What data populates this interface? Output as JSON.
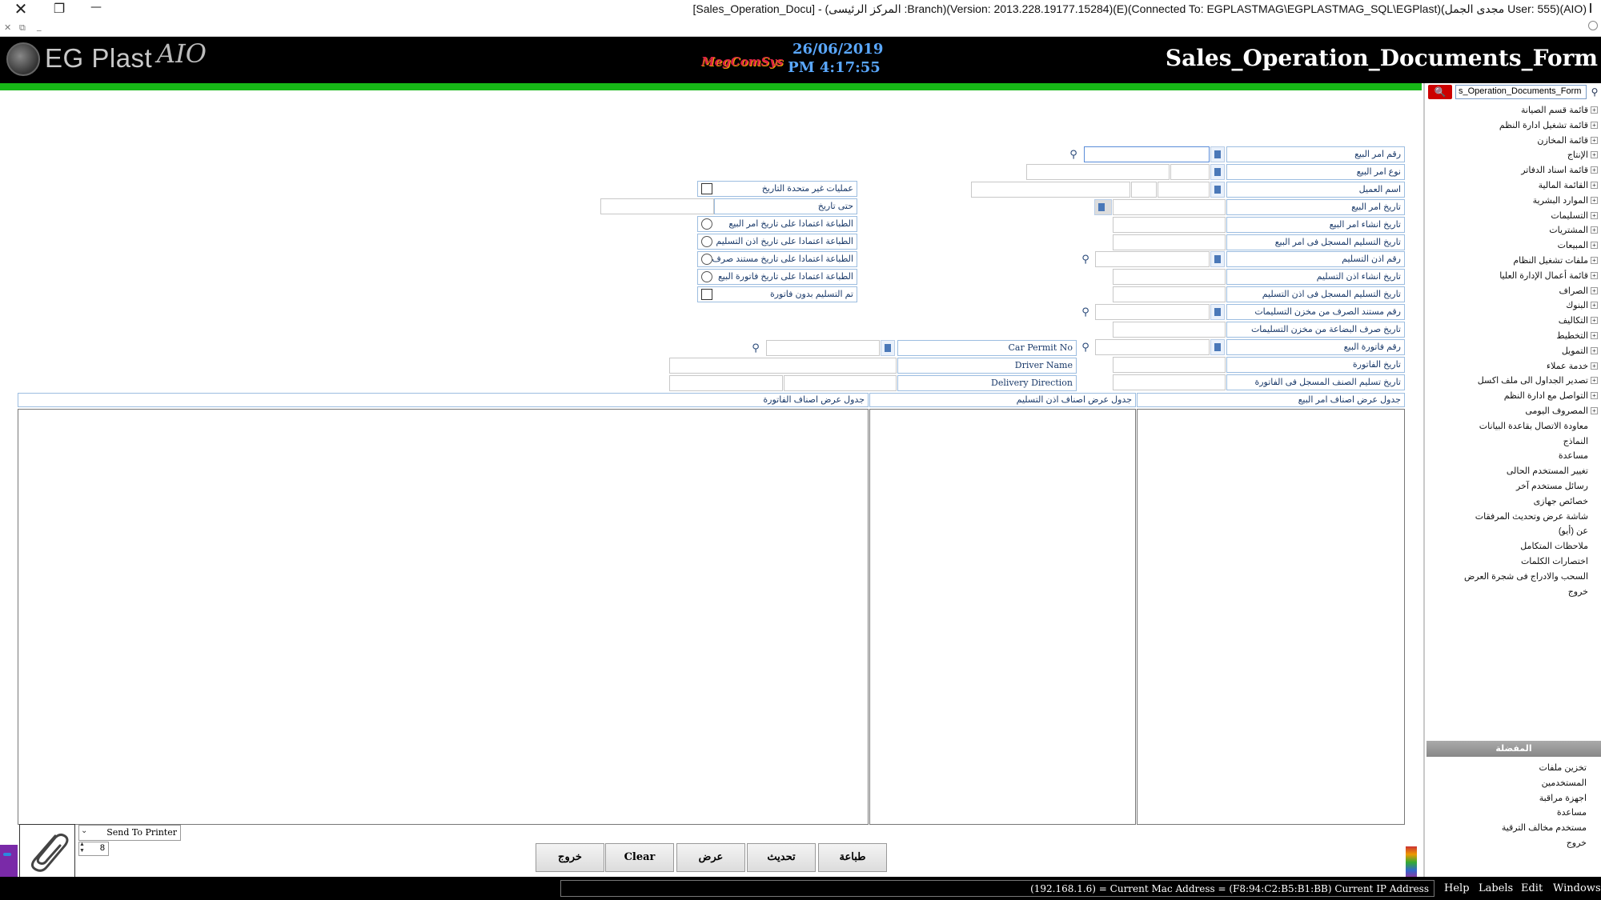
{
  "window": {
    "title": "[Sales_Operation_Docu] - (المركز الرئيسى :Branch)(Version: 2013.228.19177.15284)(E)(Connected To: EGPLASTMAG\\EGPLASTMAG_SQL\\EGPlast)(مجدى الجمل User: 555)(AIO)",
    "close_glyph": "✕",
    "restore_glyph": "❐",
    "minimize_glyph": "—",
    "mini_close": "✕",
    "mini_restore": "⧉",
    "mini_minimize": "_"
  },
  "header": {
    "logo_text": "EG Plast",
    "logo_signature": "AIO",
    "brand_small": "MegComSys",
    "date": "26/06/2019",
    "time": "PM 4:17:55",
    "form_title": "Sales_Operation_Documents_Form"
  },
  "colors": {
    "green_bar": "#17b817",
    "header_bg": "#000000",
    "date_color": "#5aa8ff",
    "label_border": "#9cbde0"
  },
  "sidebar": {
    "search_value": "s_Operation_Documents_Form",
    "search_button_icon": "search-icon",
    "tree": [
      {
        "label": "قائمة قسم الصيانة",
        "expandable": true
      },
      {
        "label": "قائمة تشغيل ادارة النظم",
        "expandable": true
      },
      {
        "label": "قائمة المخازن",
        "expandable": true
      },
      {
        "label": "الإنتاج",
        "expandable": true
      },
      {
        "label": "قائمة اسناد الدفاتر",
        "expandable": true
      },
      {
        "label": "القائمة المالية",
        "expandable": true
      },
      {
        "label": "الموارد البشرية",
        "expandable": true
      },
      {
        "label": "التسليمات",
        "expandable": true
      },
      {
        "label": "المشتريات",
        "expandable": true
      },
      {
        "label": "المبيعات",
        "expandable": true
      },
      {
        "label": "ملفات تشغيل النظام",
        "expandable": true
      },
      {
        "label": "قائمة أعمال الإدارة العليا",
        "expandable": true
      },
      {
        "label": "الصراف",
        "expandable": true
      },
      {
        "label": "البنوك",
        "expandable": true
      },
      {
        "label": "التكاليف",
        "expandable": true
      },
      {
        "label": "التخطيط",
        "expandable": true
      },
      {
        "label": "التمويل",
        "expandable": true
      },
      {
        "label": "خدمة عملاء",
        "expandable": true
      },
      {
        "label": "تصدير الجداول الى ملف اكسل",
        "expandable": true
      },
      {
        "label": "التواصل مع ادارة النظم",
        "expandable": true
      },
      {
        "label": "المصروف اليومى",
        "expandable": true
      },
      {
        "label": "معاودة الاتصال بقاعدة البيانات",
        "expandable": false
      },
      {
        "label": "النماذج",
        "expandable": false
      },
      {
        "label": "مساعدة",
        "expandable": false
      },
      {
        "label": "تغيير المستخدم الحالى",
        "expandable": false
      },
      {
        "label": "رسائل مستخدم آخر",
        "expandable": false
      },
      {
        "label": "خصائص جهازى",
        "expandable": false
      },
      {
        "label": "شاشة عرض وتحديث المرفقات",
        "expandable": false
      },
      {
        "label": "عن (أيو)",
        "expandable": false
      },
      {
        "label": "ملاحظات المتكامل",
        "expandable": false
      },
      {
        "label": "اختصارات الكلمات",
        "expandable": false
      },
      {
        "label": "السحب والادراج فى شجرة العرض",
        "expandable": false
      },
      {
        "label": "خروج",
        "expandable": false
      }
    ],
    "favorites_header": "المفضلة",
    "favorites": [
      {
        "label": "تخزين ملفات"
      },
      {
        "label": "المستخدمين"
      },
      {
        "label": "اجهزة مراقبة"
      },
      {
        "label": "مساعدة"
      },
      {
        "label": "مستخدم مخالف الترقية"
      },
      {
        "label": "خروج"
      }
    ]
  },
  "form": {
    "right_fields": [
      {
        "label": "رقم امر البيع",
        "type": "lookup"
      },
      {
        "label": "نوع امر البيع",
        "type": "combo"
      },
      {
        "label": "اسم العميل",
        "type": "combo3"
      },
      {
        "label": "تاريخ امر البيع",
        "type": "date"
      },
      {
        "label": "تاريخ انشاء امر البيع",
        "type": "text"
      },
      {
        "label": "تاريخ التسليم المسجل فى امر البيع",
        "type": "text"
      },
      {
        "label": "رقم اذن التسليم",
        "type": "lookup"
      },
      {
        "label": "تاريخ انشاء اذن التسليم",
        "type": "text"
      },
      {
        "label": "تاريخ التسليم المسجل فى اذن التسليم",
        "type": "text"
      },
      {
        "label": "رقم مستند الصرف من مخزن التسليمات",
        "type": "lookup"
      },
      {
        "label": "تاريخ صرف البضاعة من مخزن التسليمات",
        "type": "text"
      },
      {
        "label": "رقم فاتورة البيع",
        "type": "lookup"
      },
      {
        "label": "تاريخ الفاتورة",
        "type": "text"
      },
      {
        "label": "تاريخ تسليم الصنف المسجل فى الفاتورة",
        "type": "text"
      }
    ],
    "options": {
      "non_unified_dates": "عمليات غير متحدة التاريخ",
      "until_date": "حتى تاريخ",
      "print_by_order_date": "الطباعة اعتمادا على تاريخ امر البيع",
      "print_by_delivery_date": "الطباعة اعتمادا على تاريخ اذن التسليم",
      "print_by_issue_doc_date": "الطباعة اعتمادا على تاريخ مستند صرف",
      "print_by_invoice_date": "الطباعة اعتمادا على تاريخ فاتورة البيع",
      "delivered_without_invoice": "تم التسليم بدون فاتورة"
    },
    "car_permit_label": "Car Permit No",
    "driver_name_label": "Driver Name",
    "delivery_direction_label": "Delivery Direction",
    "grids": {
      "order_items": "جدول عرض اصناف امر البيع",
      "delivery_items": "جدول عرض اصناف اذن التسليم",
      "invoice_items": "جدول عرض اصناف الفاتورة"
    }
  },
  "bottom": {
    "send_to_printer": "Send To Printer",
    "copies": "8",
    "buttons": {
      "print": "طباعة",
      "refresh": "تحديث",
      "view": "عرض",
      "clear": "Clear",
      "exit": "خروج"
    }
  },
  "status": {
    "text": "(192.168.1.6) = Current Mac Address = (F8:94:C2:B5:B1:BB) Current IP Address",
    "menu": [
      "Help",
      "Labels",
      "Edit",
      "Windows"
    ]
  }
}
